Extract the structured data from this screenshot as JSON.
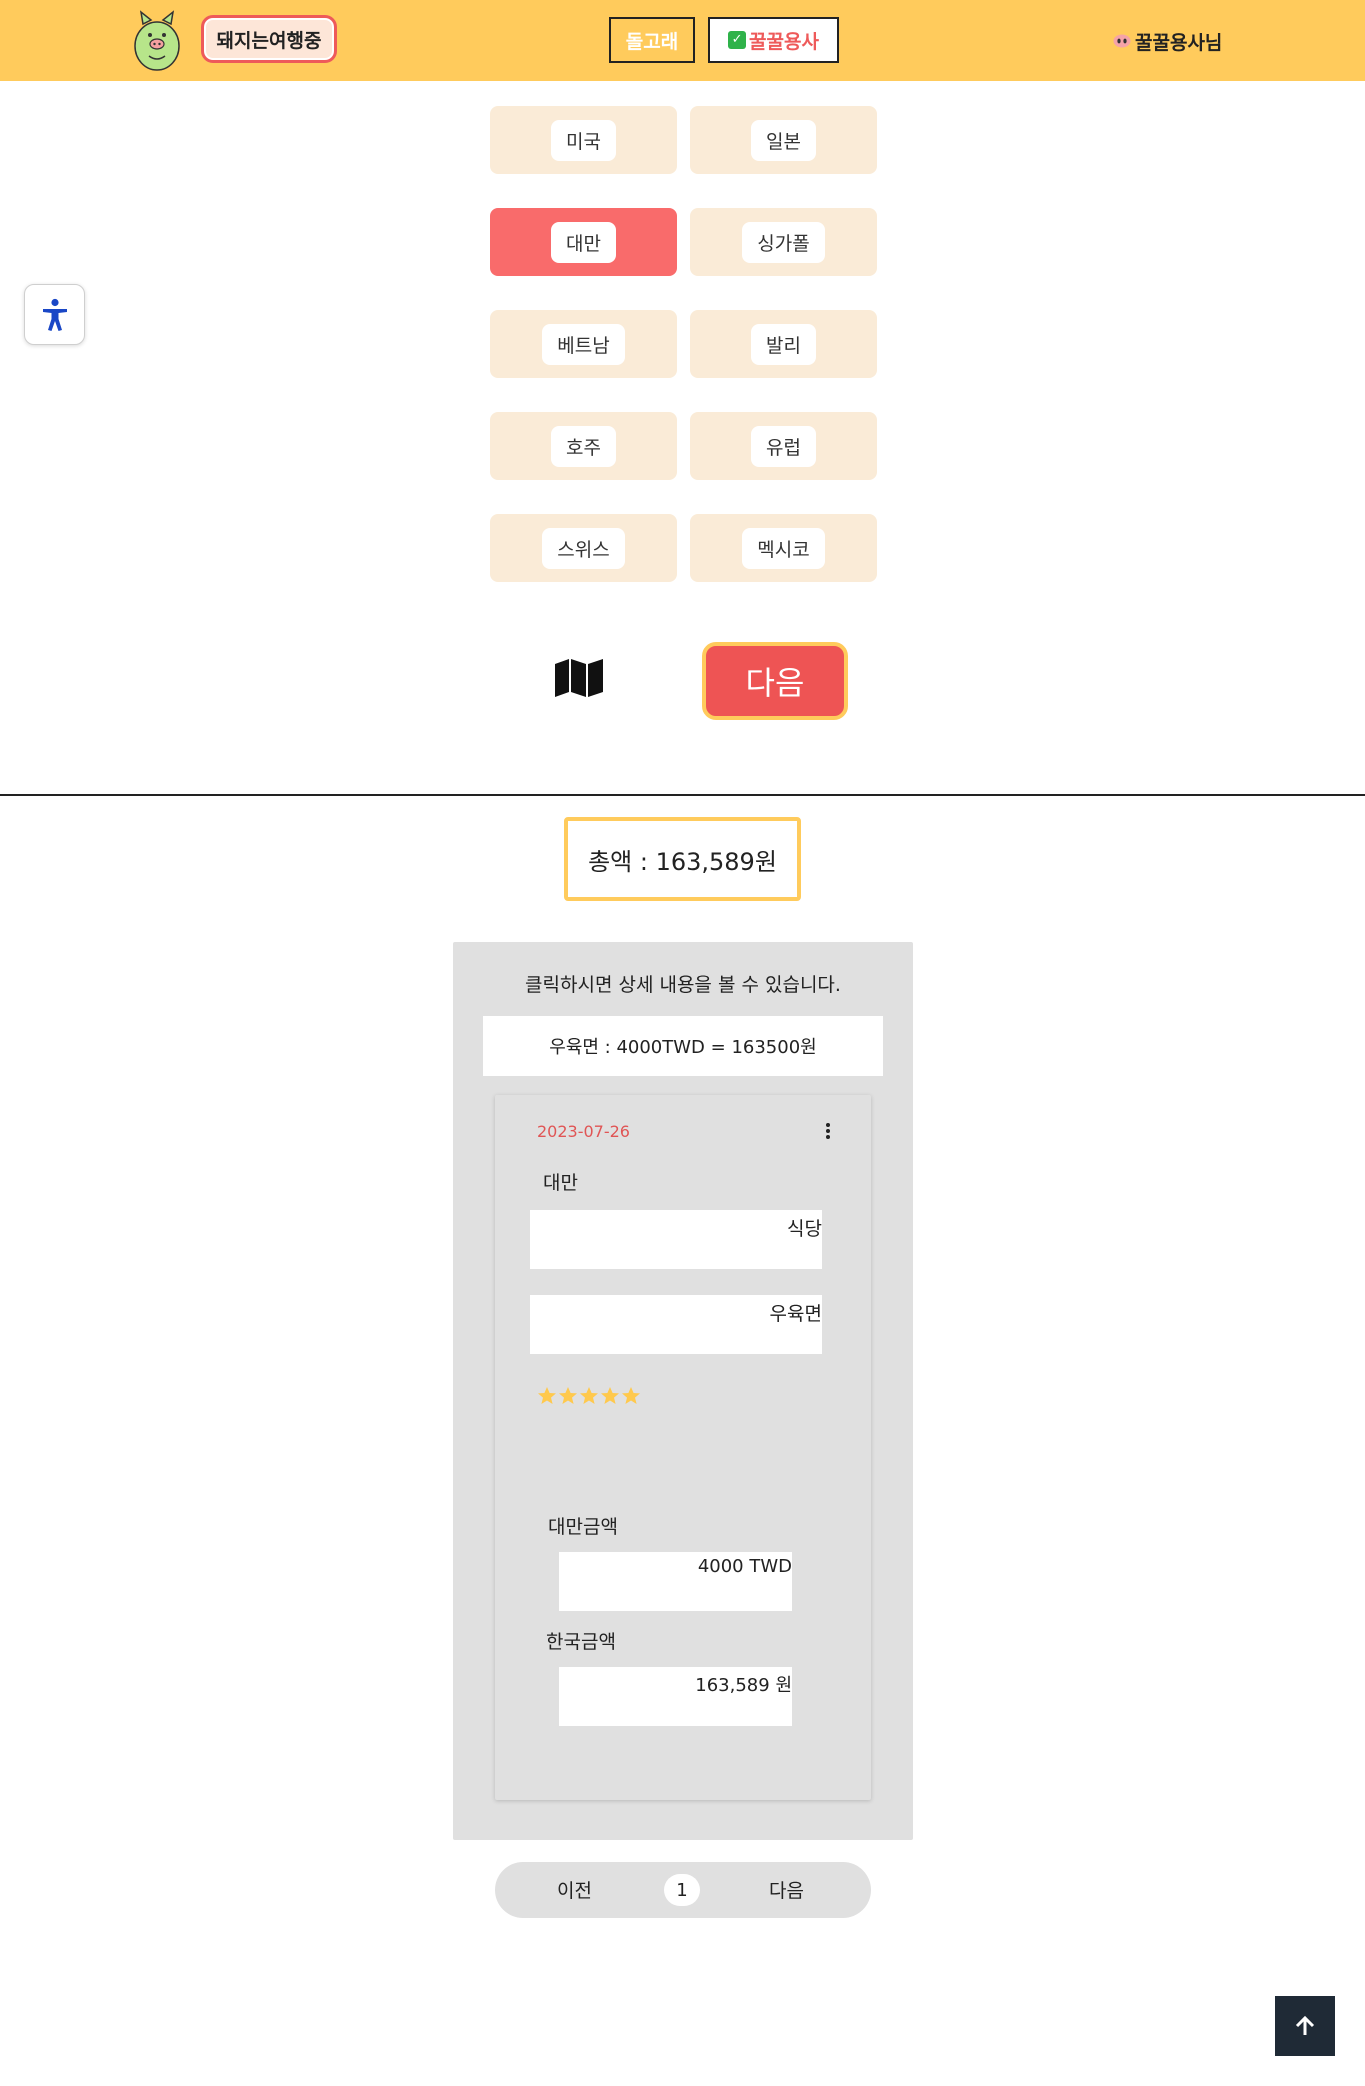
{
  "header": {
    "brand_label": "돼지는여행중",
    "nav": [
      {
        "label": "돌고래"
      },
      {
        "label": "꿀꿀용사"
      }
    ],
    "user_label": "꿀꿀용사님",
    "accent": "#ffcb5c"
  },
  "countries": [
    {
      "label": "미국"
    },
    {
      "label": "일본"
    },
    {
      "label": "대만",
      "selected": true
    },
    {
      "label": "싱가폴"
    },
    {
      "label": "베트남"
    },
    {
      "label": "발리"
    },
    {
      "label": "호주"
    },
    {
      "label": "유럽"
    },
    {
      "label": "스위스"
    },
    {
      "label": "멕시코"
    }
  ],
  "actions": {
    "map_icon": "map-icon",
    "next_label": "다음"
  },
  "total_label": "총액 : 163,589원",
  "history": {
    "hint": "클릭하시면 상세 내용을 볼 수 있습니다.",
    "summary": "우육면 : 4000TWD  =  163500원",
    "card": {
      "date": "2023-07-26",
      "country": "대만",
      "category": "식당",
      "menu": "우육면",
      "rating": 5,
      "local_label": "대만금액",
      "local_value": "4000 TWD",
      "krw_label": "한국금액",
      "krw_value": "163,589 원"
    }
  },
  "pagination": {
    "prev_label": "이전",
    "page": "1",
    "next_label": "다음"
  },
  "colors": {
    "selected": "#f96b6b",
    "primary_button": "#ee5454",
    "chip_bg": "#faebd7",
    "star": "#ffc94d"
  }
}
